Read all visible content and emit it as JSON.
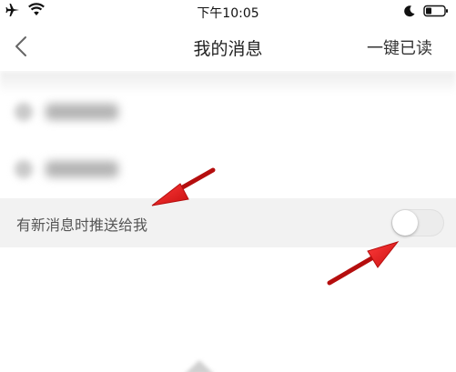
{
  "status_bar": {
    "time": "下午10:05",
    "icons": [
      "airplane-icon",
      "wifi-icon",
      "moon-icon",
      "battery-icon"
    ]
  },
  "nav": {
    "back_icon": "chevron-left-icon",
    "title": "我的消息",
    "mark_all_read": "一键已读"
  },
  "message_list": {
    "rows_blurred": 2
  },
  "settings": {
    "push_label": "有新消息时推送给我",
    "push_enabled": false
  },
  "annotations": {
    "arrow_color": "#e01e1e",
    "arrows": [
      "arrow-to-push-label",
      "arrow-to-toggle"
    ]
  },
  "colors": {
    "background": "#ffffff",
    "row_background": "#f2f2f2",
    "toggle_off": "#ececec"
  }
}
